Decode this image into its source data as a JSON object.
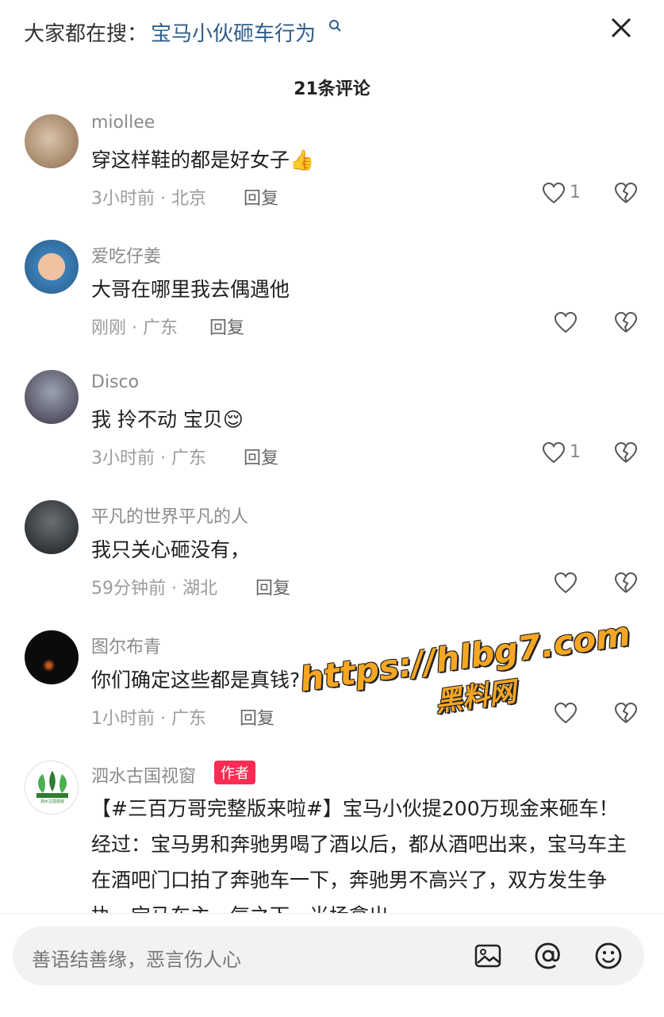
{
  "header": {
    "search_prefix": "大家都在搜：",
    "search_term": "宝马小伙砸车行为",
    "comment_count": "21条评论"
  },
  "comments": [
    {
      "username": "miollee",
      "text": "穿这样鞋的都是好女子👍",
      "time_location": "3小时前 · 北京",
      "reply": "回复",
      "likes": "1"
    },
    {
      "username": "爱吃仔姜",
      "text": "大哥在哪里我去偶遇他",
      "time_location": "刚刚 · 广东",
      "reply": "回复",
      "likes": ""
    },
    {
      "username": "Disco",
      "text": "我 拎不动 宝贝😌",
      "time_location": "3小时前 · 广东",
      "reply": "回复",
      "likes": "1"
    },
    {
      "username": "平凡的世界平凡的人",
      "text": "我只关心砸没有，",
      "time_location": "59分钟前 · 湖北",
      "reply": "回复",
      "likes": ""
    },
    {
      "username": "图尔布青",
      "text": "你们确定这些都是真钱?",
      "time_location": "1小时前 · 广东",
      "reply": "回复",
      "likes": ""
    },
    {
      "username": "泗水古国视窗",
      "badge": "作者",
      "avatar_text": "泗水古国视窗",
      "text": "【#三百万哥完整版来啦#】宝马小伙提200万现金来砸车！经过：宝马男和奔驰男喝了酒以后，都从酒吧出来，宝马车主在酒吧门口拍了奔驰车一下，奔驰男不高兴了，双方发生争执，宝马车主一气之下，当场拿出"
    }
  ],
  "watermark": {
    "url": "https://hlbg7.com",
    "name": "黑料网"
  },
  "bottom": {
    "placeholder": "善语结善缘，恶言伤人心"
  },
  "colors": {
    "accent_link": "#2f5c8a",
    "author_badge": "#fe2c55",
    "watermark": "#f5a623"
  }
}
